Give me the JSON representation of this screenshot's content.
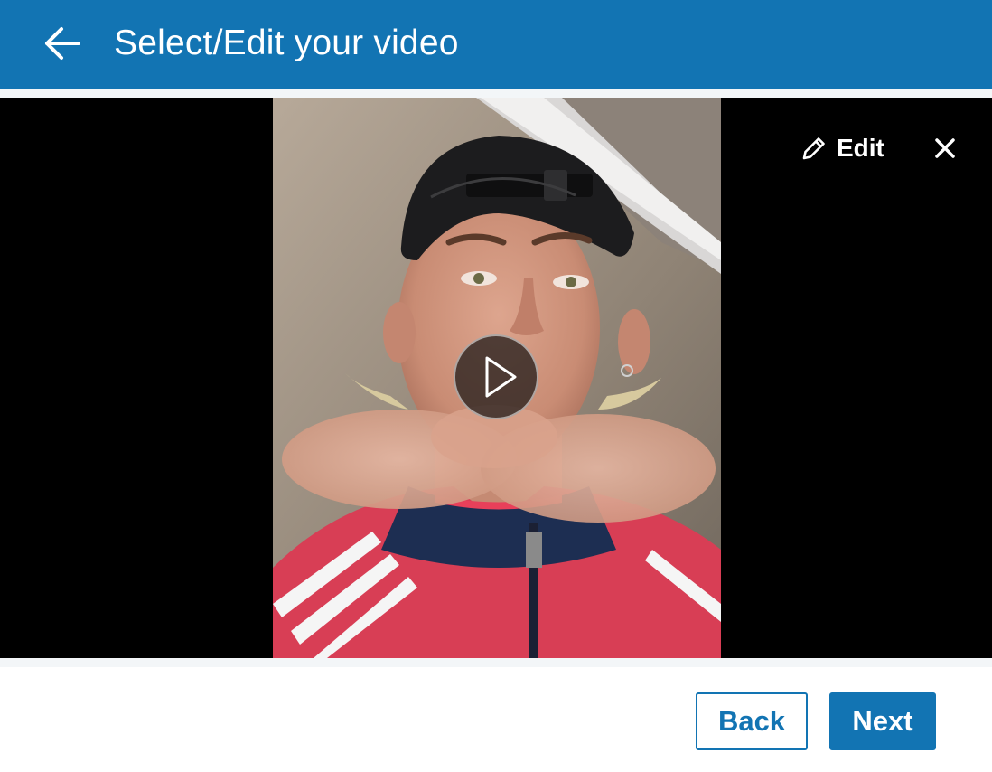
{
  "header": {
    "title": "Select/Edit your video",
    "back_icon": "arrow-left-icon",
    "background_color": "#1274b3"
  },
  "video": {
    "play_icon": "play-icon",
    "edit_label": "Edit",
    "edit_icon": "pencil-icon",
    "close_icon": "close-icon"
  },
  "footer": {
    "back_label": "Back",
    "next_label": "Next",
    "accent_color": "#1274b3"
  }
}
